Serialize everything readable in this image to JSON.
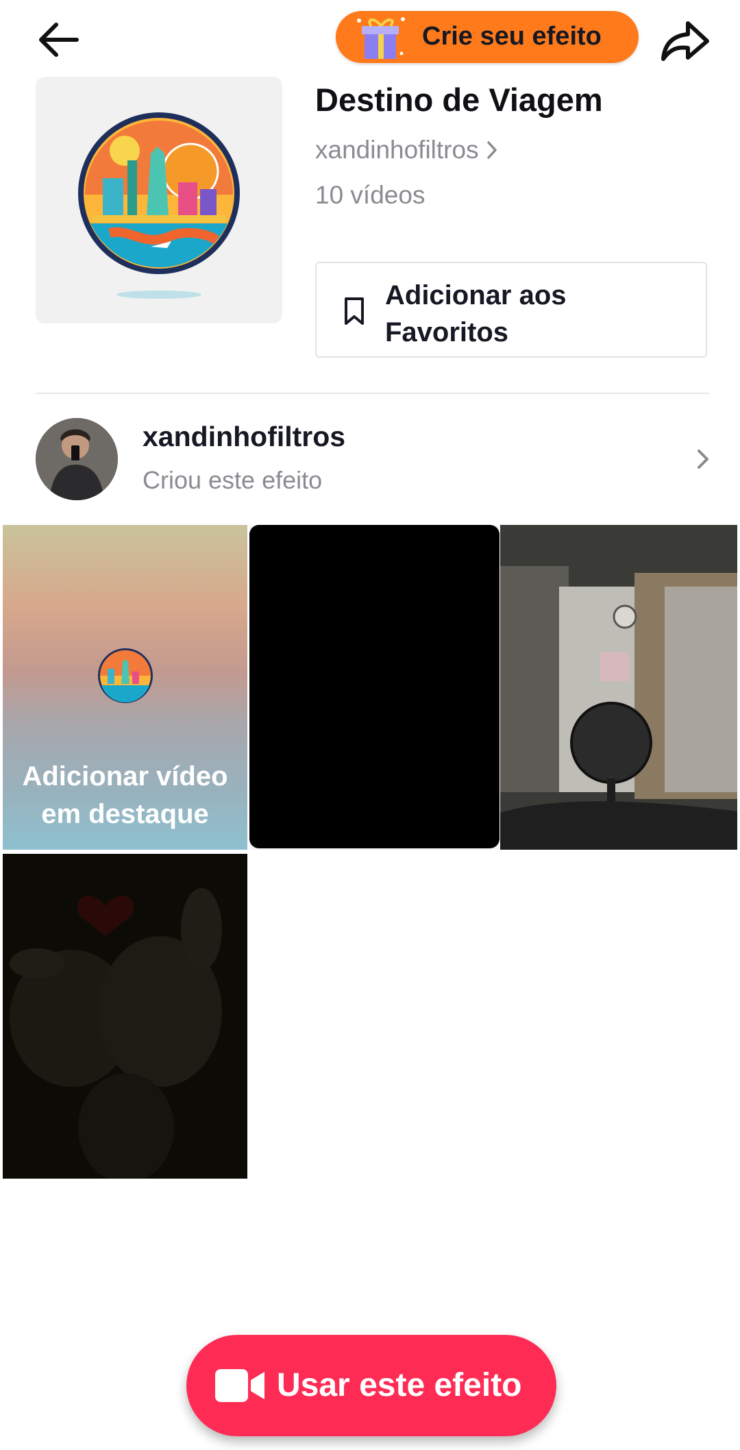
{
  "header": {
    "promo_label": "Crie seu efeito",
    "back_icon": "arrow-left-icon",
    "share_icon": "share-arrow-icon"
  },
  "effect": {
    "title": "Destino de Viagem",
    "creator_link": "xandinhofiltros",
    "video_count": "10 vídeos",
    "favorite_label": "Adicionar aos Favoritos"
  },
  "creator": {
    "name": "xandinhofiltros",
    "subtitle": "Criou este efeito"
  },
  "grid": {
    "featured_label": "Adicionar vídeo em destaque"
  },
  "cta": {
    "label": "Usar este efeito",
    "icon": "video-camera-icon"
  },
  "colors": {
    "accent": "#fe2c55",
    "promo": "#ff7a1a"
  }
}
